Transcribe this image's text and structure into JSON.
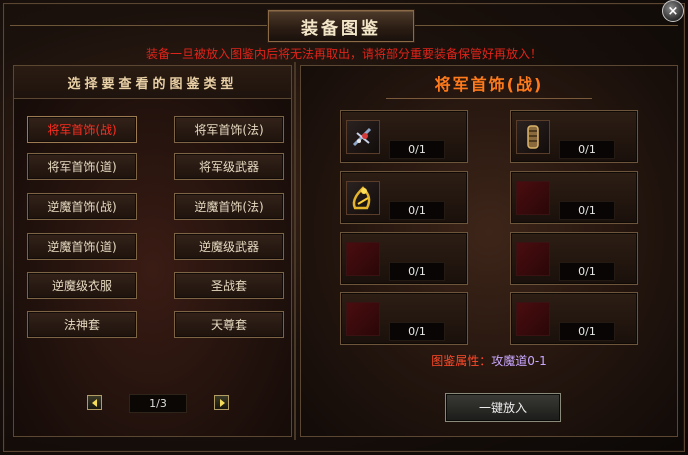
{
  "window": {
    "title": "装备图鉴",
    "close_label": "×",
    "warning": "装备一旦被放入图鉴内后将无法再取出，请将部分重要装备保管好再放入！"
  },
  "left": {
    "header": "选择要查看的图鉴类型",
    "categories": [
      {
        "label": "将军首饰(战)",
        "active": true
      },
      {
        "label": "将军首饰(法)",
        "active": false
      },
      {
        "label": "将军首饰(道)",
        "active": false
      },
      {
        "label": "将军级武器",
        "active": false
      },
      {
        "label": "逆魔首饰(战)",
        "active": false
      },
      {
        "label": "逆魔首饰(法)",
        "active": false
      },
      {
        "label": "逆魔首饰(道)",
        "active": false
      },
      {
        "label": "逆魔级武器",
        "active": false
      },
      {
        "label": "逆魔级衣服",
        "active": false
      },
      {
        "label": "圣战套",
        "active": false
      },
      {
        "label": "法神套",
        "active": false
      },
      {
        "label": "天尊套",
        "active": false
      }
    ],
    "pager": {
      "page": "1/3"
    }
  },
  "right": {
    "title": "将军首饰(战)",
    "slots": [
      {
        "count": "0/1",
        "icon": "necklace-icon"
      },
      {
        "count": "0/1",
        "icon": "bracelet-icon"
      },
      {
        "count": "0/1",
        "icon": "ring-icon"
      },
      {
        "count": "0/1",
        "icon": "empty-slot-icon"
      },
      {
        "count": "0/1",
        "icon": "empty-slot-icon"
      },
      {
        "count": "0/1",
        "icon": "empty-slot-icon"
      },
      {
        "count": "0/1",
        "icon": "empty-slot-icon"
      },
      {
        "count": "0/1",
        "icon": "empty-slot-icon"
      }
    ],
    "attribute_label": "图鉴属性：",
    "attribute_value": "攻魔道0-1",
    "onekey_label": "一键放入"
  },
  "colors": {
    "active_category": "#ff2d1f",
    "warning": "#e0241a",
    "right_title": "#ff7a1c",
    "attribute_value": "#c9a7ff"
  }
}
